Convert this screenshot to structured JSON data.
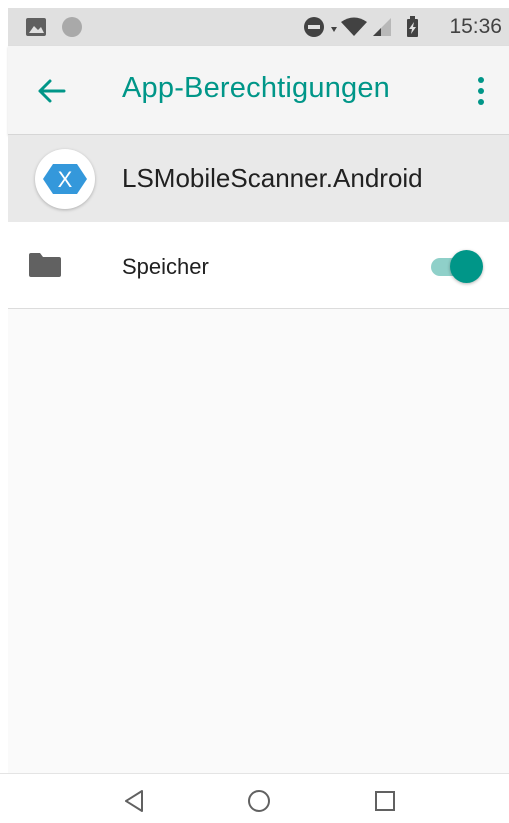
{
  "status_bar": {
    "time": "15:36",
    "icons": [
      "image-notification-icon",
      "circle-notification-icon",
      "do-not-disturb-icon",
      "wifi-icon",
      "signal-icon",
      "battery-charging-icon"
    ]
  },
  "app_bar": {
    "title": "App-Berechtigungen",
    "back_icon": "arrow-back-icon",
    "menu_icon": "more-vert-icon"
  },
  "app": {
    "name": "LSMobileScanner.Android",
    "icon": "xamarin-app-icon",
    "icon_letter": "X",
    "icon_color": "#3498db"
  },
  "permissions": [
    {
      "label": "Speicher",
      "icon": "folder-icon",
      "enabled": true
    }
  ],
  "nav_bar": {
    "buttons": [
      "back-triangle-icon",
      "home-circle-icon",
      "recents-square-icon"
    ]
  },
  "colors": {
    "accent": "#009688",
    "accent_light": "#8fd0c9",
    "status_bar_bg": "#e0e0e0",
    "app_bar_bg": "#f5f5f5",
    "app_row_bg": "#e9e9e9"
  }
}
